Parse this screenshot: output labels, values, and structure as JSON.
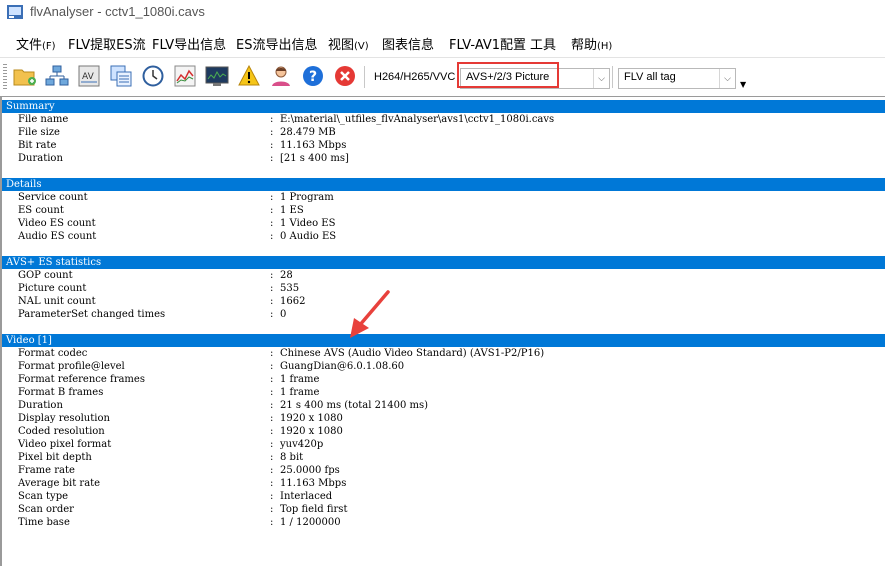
{
  "window": {
    "title": "flvAnalyser - cctv1_1080i.cavs"
  },
  "menu": [
    {
      "label": "文件",
      "accel": "(F)"
    },
    {
      "label": "FLV提取ES流",
      "accel": ""
    },
    {
      "label": "FLV导出信息",
      "accel": ""
    },
    {
      "label": "ES流导出信息",
      "accel": ""
    },
    {
      "label": "视图",
      "accel": "(V)"
    },
    {
      "label": "图表信息",
      "accel": ""
    },
    {
      "label": "FLV-AV1配置",
      "accel": ""
    },
    {
      "label": "工具",
      "accel": ""
    },
    {
      "label": "帮助",
      "accel": "(H)"
    }
  ],
  "toolbar": {
    "buttons": [
      "open-folder-icon",
      "network-icon",
      "av-icon",
      "windows-icon",
      "clock-icon",
      "chart-icon",
      "monitor-icon",
      "warning-icon",
      "user-icon",
      "help-icon",
      "close-icon"
    ],
    "codec_label": "H264/H265/VVC",
    "codec_combo_value": "AVS+/2/3 Picture",
    "flv_combo_value": "FLV all tag"
  },
  "sections": [
    {
      "title": "Summary",
      "rows": [
        {
          "key": "File name",
          "value": "E:\\material\\_utfiles_flvAnalyser\\avs1\\cctv1_1080i.cavs"
        },
        {
          "key": "File size",
          "value": "28.479 MB"
        },
        {
          "key": "Bit rate",
          "value": "11.163 Mbps"
        },
        {
          "key": "Duration",
          "value": "[21 s 400 ms]"
        }
      ]
    },
    {
      "title": "Details",
      "rows": [
        {
          "key": "Service count",
          "value": "1 Program"
        },
        {
          "key": "ES count",
          "value": "1 ES"
        },
        {
          "key": "Video ES count",
          "value": "1 Video ES"
        },
        {
          "key": "Audio ES count",
          "value": "0 Audio ES"
        }
      ]
    },
    {
      "title": "AVS+ ES statistics",
      "rows": [
        {
          "key": "GOP count",
          "value": "28"
        },
        {
          "key": "Picture count",
          "value": "535"
        },
        {
          "key": "NAL unit count",
          "value": "1662"
        },
        {
          "key": "ParameterSet changed times",
          "value": "0"
        }
      ]
    },
    {
      "title": "Video [1]",
      "rows": [
        {
          "key": "Format codec",
          "value": "Chinese AVS (Audio Video Standard) (AVS1-P2/P16)"
        },
        {
          "key": "Format profile@level",
          "value": "GuangDian@6.0.1.08.60"
        },
        {
          "key": "Format reference frames",
          "value": "1 frame"
        },
        {
          "key": "Format B frames",
          "value": "1 frame"
        },
        {
          "key": "Duration",
          "value": "21 s 400 ms (total 21400 ms)"
        },
        {
          "key": "Display resolution",
          "value": "1920 x 1080"
        },
        {
          "key": "Coded resolution",
          "value": "1920 x 1080"
        },
        {
          "key": "Video pixel format",
          "value": "yuv420p"
        },
        {
          "key": "Pixel bit depth",
          "value": "8 bit"
        },
        {
          "key": "Frame rate",
          "value": "25.0000 fps"
        },
        {
          "key": "Average bit rate",
          "value": "11.163 Mbps"
        },
        {
          "key": "Scan type",
          "value": "Interlaced"
        },
        {
          "key": "Scan order",
          "value": "Top field first"
        },
        {
          "key": "Time base",
          "value": "1 / 1200000"
        }
      ]
    }
  ],
  "colors": {
    "section_header": "#0078d7",
    "highlight_box": "#e53935",
    "annotation_arrow": "#e8413c"
  }
}
